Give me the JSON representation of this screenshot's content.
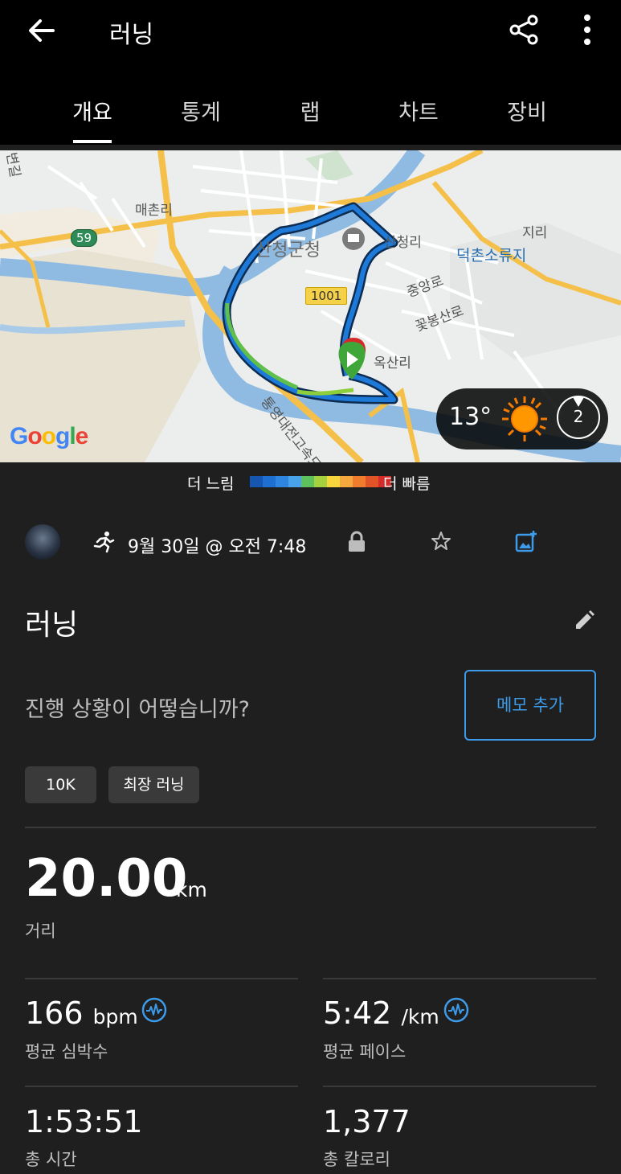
{
  "header": {
    "title": "러닝",
    "tabs": [
      {
        "label": "개요",
        "active": true
      },
      {
        "label": "통계",
        "active": false
      },
      {
        "label": "랩",
        "active": false
      },
      {
        "label": "차트",
        "active": false
      },
      {
        "label": "장비",
        "active": false
      }
    ]
  },
  "map": {
    "labels": {
      "meachonri": "매촌리",
      "sancheong_gun": "산청군청",
      "sancheongri": "산청리",
      "jiri": "지리",
      "deokchon": "덕촌소류지",
      "jungangro": "중앙로",
      "kkotbongsanro": "꽃봉산로",
      "oksanri": "옥산리",
      "highway": "통영대전고속도로",
      "byeonil": "변길"
    },
    "road_59": "59",
    "road_1001": "1001",
    "google_letters": [
      "G",
      "o",
      "o",
      "g",
      "l",
      "e"
    ],
    "weather": {
      "temperature": "13°",
      "wind": "2"
    }
  },
  "legend": {
    "slow_label": "더 느림",
    "fast_label": "더 빠름",
    "colors": [
      "#1557b0",
      "#1d6fd1",
      "#2f86e0",
      "#4aa3ea",
      "#5ec25c",
      "#a6d13e",
      "#f5d63d",
      "#f5a83d",
      "#f07d2e",
      "#e05427",
      "#d42b2b"
    ]
  },
  "activity": {
    "date": "9월 30일 @ 오전 7:48",
    "title": "러닝",
    "prompt": "진행 상황이 어떻습니까?",
    "memo_button": "메모 추가",
    "chips": [
      "10K",
      "최장 러닝"
    ]
  },
  "stats": {
    "distance": {
      "value": "20.00",
      "unit": "km",
      "label": "거리"
    },
    "heart_rate": {
      "value": "166",
      "unit": "bpm",
      "label": "평균 심박수"
    },
    "pace": {
      "value": "5:42",
      "unit": "/km",
      "label": "평균 페이스"
    },
    "total_time": {
      "value": "1:53:51",
      "label": "총 시간"
    },
    "calories": {
      "value": "1,377",
      "label": "총 칼로리"
    }
  },
  "colors": {
    "accent": "#3d9be9",
    "background": "#1f1f1f",
    "appbar": "#000000"
  }
}
